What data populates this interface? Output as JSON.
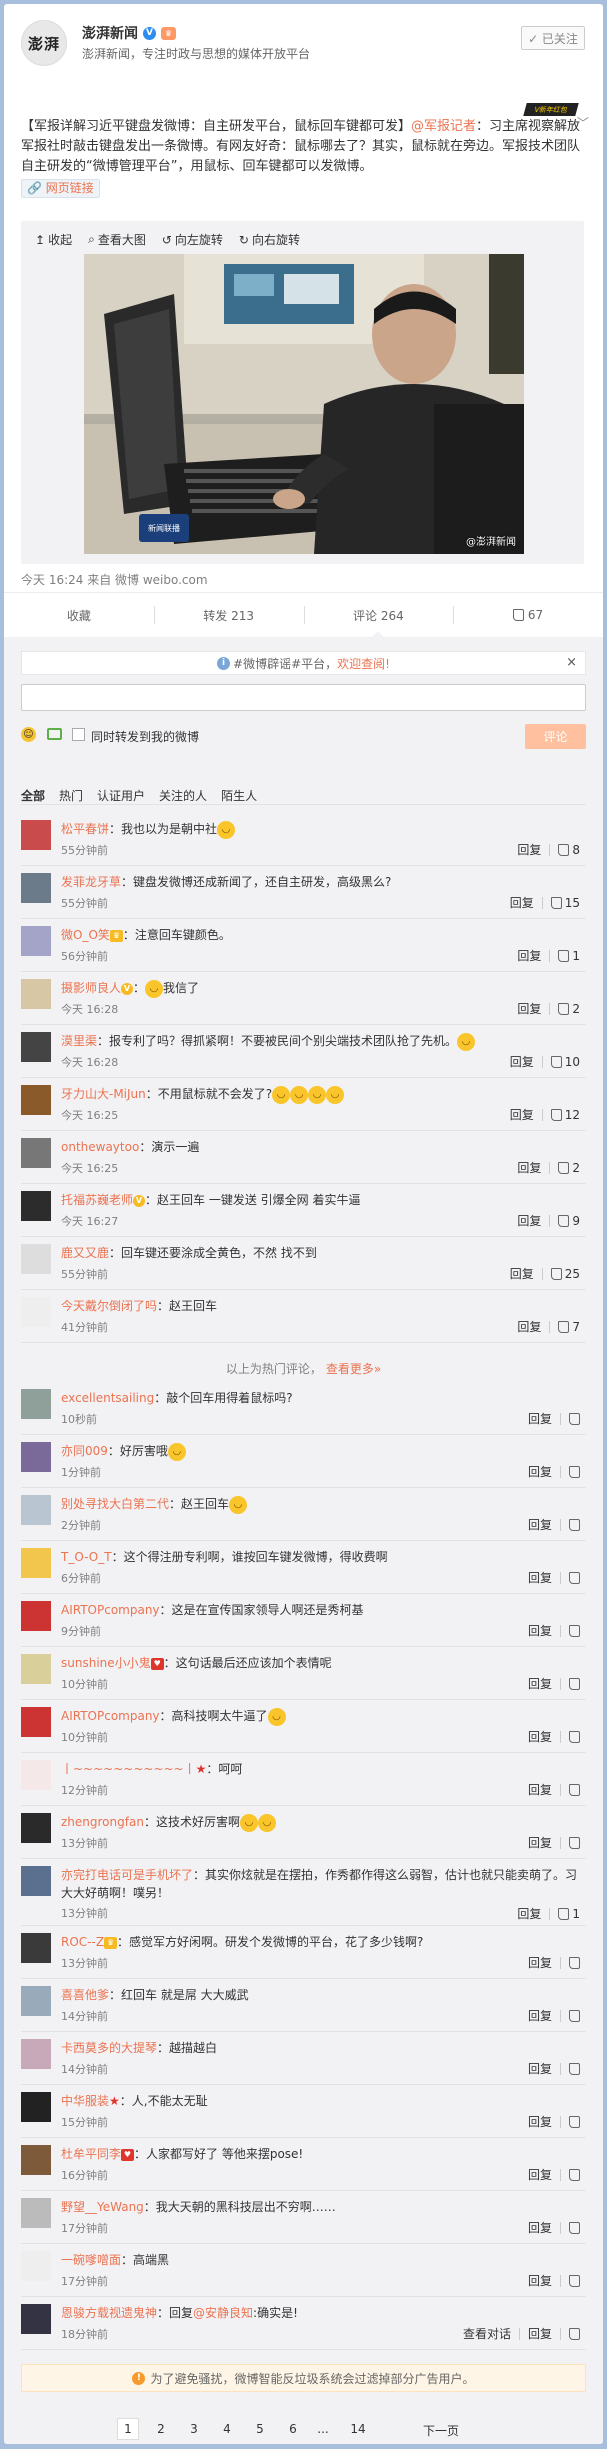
{
  "header": {
    "avatar_text": "澎湃",
    "author": "澎湃新闻",
    "intro": "澎湃新闻，专注时政与思想的媒体开放平台",
    "follow_label": "✓ 已关注",
    "ribbon": "V新年红包"
  },
  "post": {
    "text_part1": "【军报详解习近平键盘发微博：自主研发平台，鼠标回车键都可发】",
    "mention": "@军报记者",
    "text_part2": "：习主席视察解放军报社时敲击键盘发出一条微博。有网友好奇：鼠标哪去了？其实，鼠标就在旁边。军报技术团队自主研发的“微博管理平台”，用鼠标、回车键都可以发微博。",
    "web_link": "🔗 网页链接",
    "media_tools": [
      "收起",
      "查看大图",
      "向左旋转",
      "向右旋转"
    ],
    "watermark1": "新闻联播",
    "watermark2": "@澎湃新闻",
    "time_source": "今天 16:24 来自 微博 weibo.com"
  },
  "actions": {
    "collect": "收藏",
    "repost": "转发 213",
    "comment": "评论 264",
    "like": "67"
  },
  "comments_area": {
    "notice_prefix": "#微博辟谣#平台，",
    "notice_link": "欢迎查阅!",
    "repost_label": "同时转发到我的微博",
    "submit_label": "评论",
    "filters": [
      "全部",
      "热门",
      "认证用户",
      "关注的人",
      "陌生人"
    ],
    "hot_divider_text": "以上为热门评论，",
    "hot_divider_link": "查看更多»",
    "ad_notice": "为了避免骚扰，微博智能反垃圾系统会过滤掉部分广告用户。",
    "reply_label": "回复",
    "view_conversation": "查看对话"
  },
  "comments": [
    {
      "name": "松平春饼",
      "text": "：我也以为是朝中社",
      "emoji": "😏",
      "time": "55分钟前",
      "likes": "8"
    },
    {
      "name": "发菲龙牙草",
      "text": "：键盘发微博还成新闻了，还自主研发，高级黑么?",
      "time": "55分钟前",
      "likes": "15"
    },
    {
      "name": "微O_O笑",
      "text": "：注意回车键颜色。",
      "time": "56分钟前",
      "likes": "1"
    },
    {
      "name": "摄影师良人",
      "text": "：",
      "emoji": "😒",
      "text2": "我信了",
      "time": "今天 16:28",
      "likes": "2"
    },
    {
      "name": "漠里渠",
      "text": "：报专利了吗？得抓紧啊！不要被民间个别尖端技术团队抢了先机。",
      "emoji": "😏",
      "time": "今天 16:28",
      "likes": "10"
    },
    {
      "name": "牙力山大-MiJun",
      "text": "：不用鼠标就不会发了?",
      "emoji4": "😂😂😂😂",
      "time": "今天 16:25",
      "likes": "12"
    },
    {
      "name": "onthewaytoo",
      "text": "：演示一遍",
      "time": "今天 16:25",
      "likes": "2"
    },
    {
      "name": "托福苏巍老师",
      "text": "：赵王回车 一键发送 引爆全网 着实牛逼",
      "time": "今天 16:27",
      "likes": "9"
    },
    {
      "name": "鹿又又鹿",
      "text": "：回车键还要涂成全黄色，不然 找不到",
      "time": "55分钟前",
      "likes": "25"
    },
    {
      "name": "今天戴尔倒闭了吗",
      "text": "：赵王回车",
      "time": "41分钟前",
      "likes": "7"
    },
    {
      "name": "excellentsailing",
      "text": "：敲个回车用得着鼠标吗?",
      "time": "10秒前"
    },
    {
      "name": "亦同009",
      "text": "：好厉害哦",
      "emoji": "😆",
      "time": "1分钟前"
    },
    {
      "name": "别处寻找大白第二代",
      "text": "：赵王回车",
      "emoji": "😆",
      "time": "2分钟前"
    },
    {
      "name": "T_O-O_T",
      "text": "：这个得注册专利啊，谁按回车键发微博，得收费啊",
      "time": "6分钟前"
    },
    {
      "name": "AIRTOPcompany",
      "text": "：这是在宣传国家领导人啊还是秀柯基",
      "time": "9分钟前"
    },
    {
      "name": "sunshine小小鬼",
      "text": "：这句话最后还应该加个表情呢",
      "time": "10分钟前"
    },
    {
      "name": "AIRTOPcompany",
      "text": "：高科技啊太牛逼了",
      "emoji": "😏",
      "time": "10分钟前"
    },
    {
      "name": "丨~~~~~~~~~~~丨",
      "text": "：呵呵",
      "time": "12分钟前"
    },
    {
      "name": "zhengrongfan",
      "text": "：这技术好厉害啊",
      "emoji2": "😂😂",
      "time": "13分钟前"
    },
    {
      "name": "亦完打电话可是手机坏了",
      "text": "：其实你炫就是在摆拍，作秀都作得这么弱智，估计也就只能卖萌了。习大大好萌啊！噗另！",
      "time": "13分钟前",
      "likes": "1"
    },
    {
      "name": "ROC--Z",
      "text": "：感觉军方好闲啊。研发个发微博的平台，花了多少钱啊?",
      "time": "13分钟前"
    },
    {
      "name": "喜喜他爹",
      "text": "：红回车 就是屌 大大威武",
      "time": "14分钟前"
    },
    {
      "name": "卡西莫多的大提琴",
      "text": "：越描越白",
      "time": "14分钟前"
    },
    {
      "name": "中华服装",
      "text": "：人,不能太无耻",
      "time": "15分钟前"
    },
    {
      "name": "杜牟平同李",
      "text": "：人家都写好了 等他来摆pose!",
      "time": "16分钟前"
    },
    {
      "name": "野望__YeWang",
      "text": "：我大天朝的黑科技层出不穷啊……",
      "time": "17分钟前"
    },
    {
      "name": "一碗嗲噌面",
      "text": "：高端黑",
      "time": "17分钟前"
    },
    {
      "name": "恩骏方载视遗鬼神",
      "text": "：回复",
      "mention": "@安静良知",
      "text2": ":确实是!",
      "time": "18分钟前"
    }
  ],
  "pager": {
    "pages": [
      "1",
      "2",
      "3",
      "4",
      "5",
      "6",
      "...",
      "14"
    ],
    "next": "下一页"
  }
}
